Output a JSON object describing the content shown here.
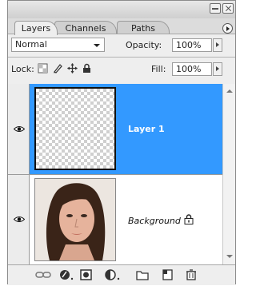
{
  "tabs": [
    {
      "label": "Layers",
      "active": true
    },
    {
      "label": "Channels",
      "active": false
    },
    {
      "label": "Paths",
      "active": false
    }
  ],
  "blend_mode": {
    "value": "Normal"
  },
  "opacity": {
    "label": "Opacity:",
    "value": "100%"
  },
  "lock": {
    "label": "Lock:"
  },
  "fill": {
    "label": "Fill:",
    "value": "100%"
  },
  "layers": [
    {
      "name": "Layer 1",
      "visible": true,
      "selected": true,
      "thumbnail": "transparent-checkerboard"
    },
    {
      "name": "Background",
      "visible": true,
      "selected": false,
      "locked": true,
      "thumbnail": "portrait-photo"
    }
  ],
  "colors": {
    "selection": "#3399ff",
    "panel_bg": "#eeeeee",
    "frame": "#dcdcdc"
  },
  "footer_icons": [
    "link-layers-icon",
    "layer-style-icon",
    "layer-mask-icon",
    "adjustment-layer-icon",
    "new-group-icon",
    "new-layer-icon",
    "delete-layer-icon"
  ]
}
